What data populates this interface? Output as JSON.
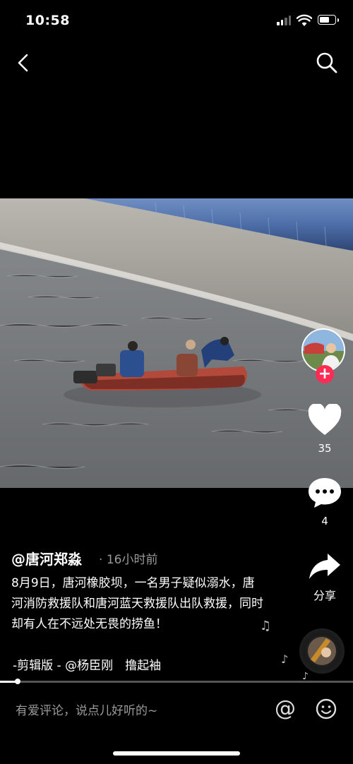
{
  "status_bar": {
    "time": "10:58",
    "battery_level": 0.55
  },
  "post": {
    "author": "@唐河郑淼",
    "separator": "·",
    "time_ago": "16小时前",
    "description": "8月9日，唐河橡胶坝，一名男子疑似溺水，唐河消防救援队和唐河蓝天救援队出队救援，同时却有人在不远处无畏的捞鱼！",
    "music": "-剪辑版 - @杨臣刚　撸起袖"
  },
  "actions": {
    "likes": "35",
    "comments": "4",
    "share_label": "分享",
    "follow_symbol": "+"
  },
  "playback": {
    "progress": 0.05
  },
  "comment_bar": {
    "placeholder": "有爱评论，说点儿好听的~",
    "at_symbol": "@"
  },
  "icons": {
    "back": "chevron-left-icon",
    "search": "search-icon",
    "like": "heart-icon",
    "comment": "comment-bubble-icon",
    "share": "share-arrow-icon",
    "emoji": "smiley-icon"
  },
  "colors": {
    "accent": "#fe2c55",
    "background": "#000000",
    "muted_text": "#9a9a9a"
  }
}
